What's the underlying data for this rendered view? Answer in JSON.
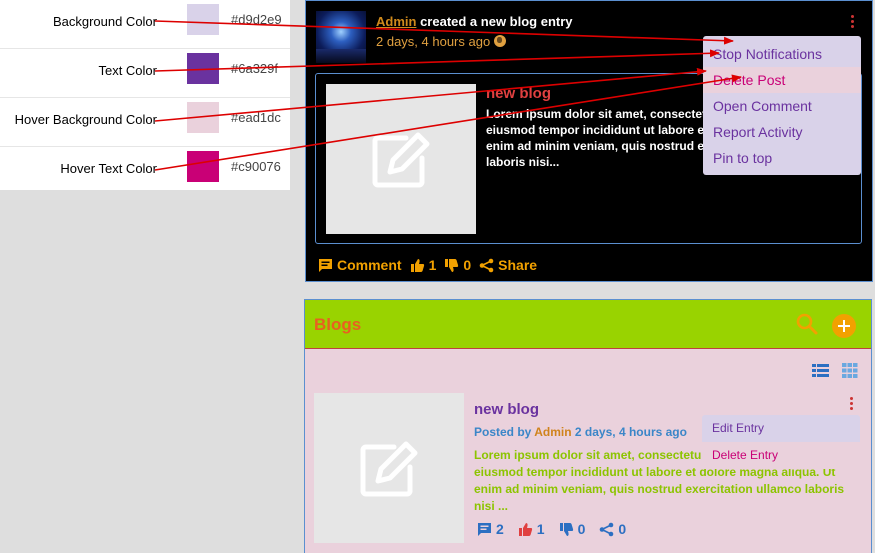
{
  "legend": {
    "rows": [
      {
        "label": "Background Color",
        "hex": "#d9d2e9",
        "color": "#d9d2e9"
      },
      {
        "label": "Text Color",
        "hex": "#6a329f",
        "color": "#6a329f"
      },
      {
        "label": "Hover Background Color",
        "hex": "#ead1dc",
        "color": "#ead1dc"
      },
      {
        "label": "Hover Text Color",
        "hex": "#c90076",
        "color": "#c90076"
      }
    ]
  },
  "activity": {
    "author": "Admin",
    "action": " created a new blog entry",
    "time": "2 days, 4 hours ago",
    "post_title": "new blog",
    "post_body": "Lorem ipsum dolor sit amet, consectetur adipiscing elit, sed do eiusmod tempor incididunt ut labore et dolore magna aliqua. Ut enim ad minim veniam, quis nostrud exercitation ullamco laboris nisi...",
    "comment_label": "Comment",
    "likes": "1",
    "dislikes": "0",
    "share_label": "Share"
  },
  "dropdown_activity": {
    "items": [
      "Stop Notifications",
      "Delete Post",
      "Open Comment",
      "Report Activity",
      "Pin to top"
    ],
    "hover_index": 1
  },
  "blogs": {
    "title": "Blogs",
    "entry": {
      "title": "new blog",
      "posted_by": "Posted by ",
      "author": "Admin",
      "time": " 2 days, 4 hours ago",
      "body": "Lorem ipsum dolor sit amet, consectetur adipiscing elit, sed do eiusmod tempor incididunt ut labore et dolore magna aliqua. Ut enim ad minim veniam, quis nostrud exercitation ullamco laboris nisi ...",
      "comments": "2",
      "likes": "1",
      "dislikes": "0",
      "shares": "0"
    }
  },
  "dropdown_blog": {
    "items": [
      "Edit Entry",
      "Delete Entry"
    ],
    "hover_index": 1
  },
  "colors": {
    "menu_bg": "#d9d2e9",
    "menu_text": "#6a329f",
    "hover_bg": "#ead1dc",
    "hover_text": "#c90076",
    "arrow": "#dd0000",
    "accent": "#f2a100"
  },
  "icons": {
    "activity": [
      "thumbnail",
      "globe-icon",
      "kebab-icon",
      "edit-placeholder-icon",
      "comment-icon",
      "thumbs-up-icon",
      "thumbs-down-icon",
      "share-icon"
    ],
    "blogs": [
      "search-icon",
      "add-icon",
      "list-view-icon",
      "grid-view-icon",
      "kebab-icon",
      "edit-placeholder-icon",
      "comment-icon",
      "thumbs-up-icon",
      "thumbs-down-icon",
      "share-icon"
    ]
  }
}
